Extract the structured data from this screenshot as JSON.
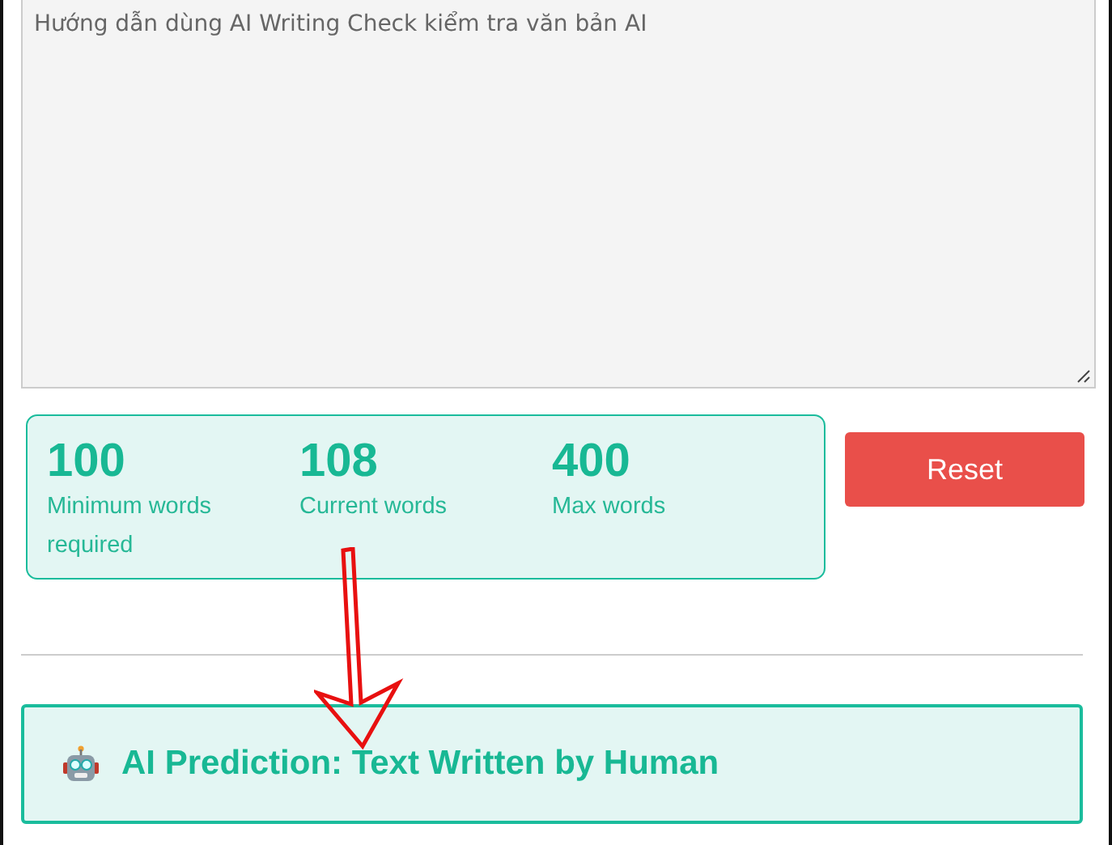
{
  "text_area": {
    "value": "Hướng dẫn dùng AI Writing Check kiểm tra văn bản AI"
  },
  "stats": [
    {
      "value": "100",
      "label": "Minimum words required"
    },
    {
      "value": "108",
      "label": "Current words"
    },
    {
      "value": "400",
      "label": "Max words"
    }
  ],
  "reset_button": {
    "label": "Reset"
  },
  "result": {
    "text": "AI Prediction: Text Written by Human"
  }
}
